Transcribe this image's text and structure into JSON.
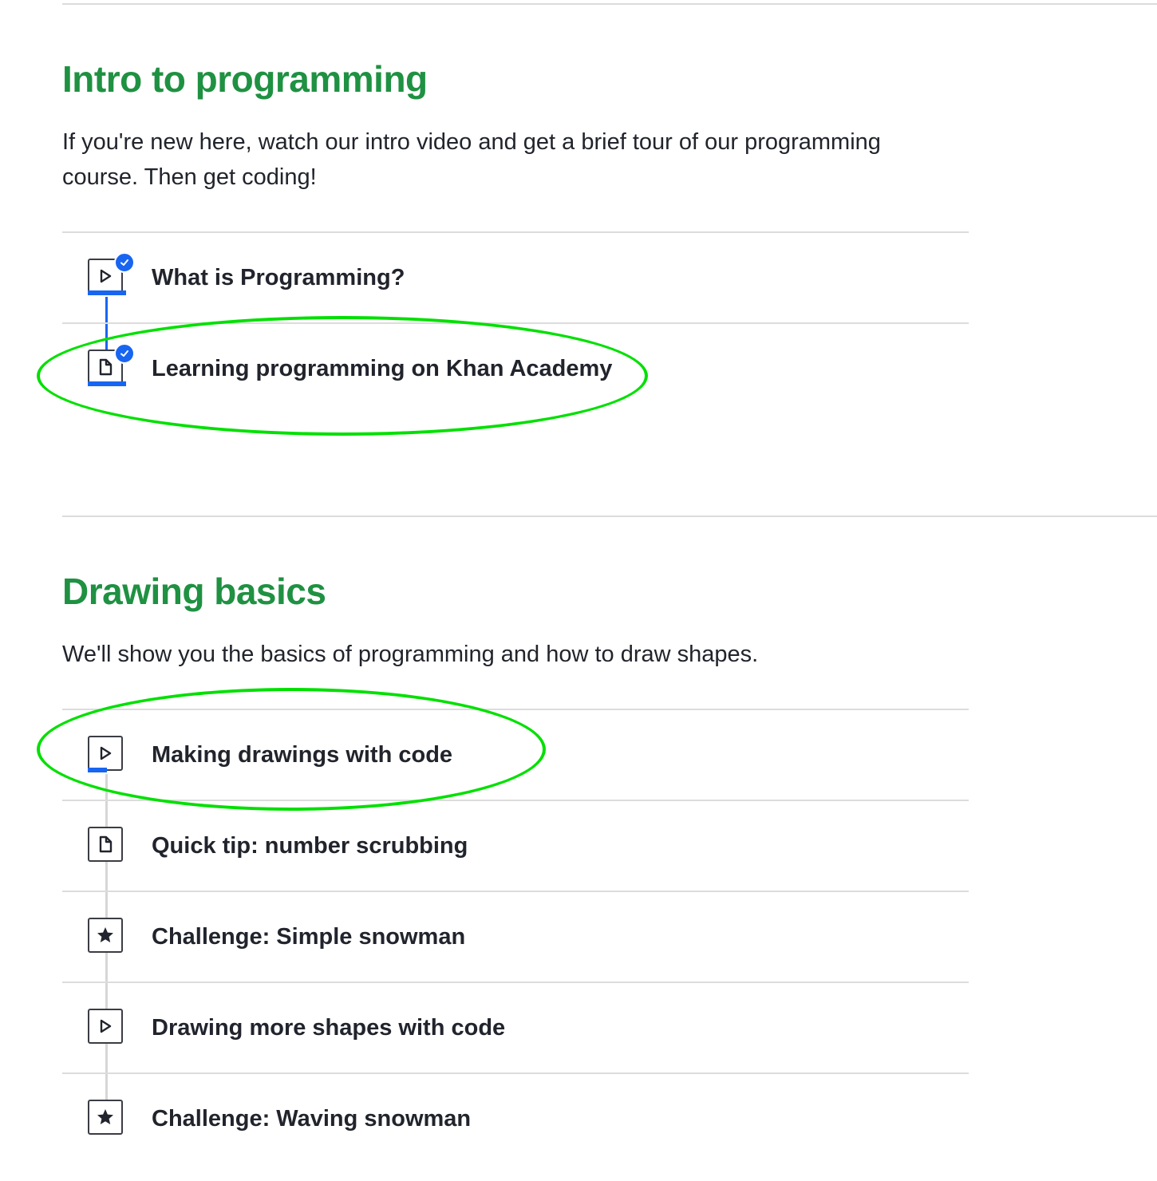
{
  "sections": [
    {
      "title": "Intro to programming",
      "description": "If you're new here, watch our intro video and get a brief tour of our programming course. Then get coding!",
      "items": [
        {
          "label": "What is Programming?",
          "icon": "play-icon",
          "completed": true
        },
        {
          "label": "Learning programming on Khan Academy",
          "icon": "article-icon",
          "completed": true
        }
      ]
    },
    {
      "title": "Drawing basics",
      "description": "We'll show you the basics of programming and how to draw shapes.",
      "items": [
        {
          "label": "Making drawings with code",
          "icon": "play-icon",
          "completed": false,
          "progress": 0.5
        },
        {
          "label": "Quick tip: number scrubbing",
          "icon": "article-icon",
          "completed": false
        },
        {
          "label": "Challenge: Simple snowman",
          "icon": "star-icon",
          "completed": false
        },
        {
          "label": "Drawing more shapes with code",
          "icon": "play-icon",
          "completed": false
        },
        {
          "label": "Challenge: Waving snowman",
          "icon": "star-icon",
          "completed": false
        }
      ]
    }
  ],
  "colors": {
    "title_green": "#1f9142",
    "progress_blue": "#1865f2",
    "annotation_green": "#00e000"
  }
}
